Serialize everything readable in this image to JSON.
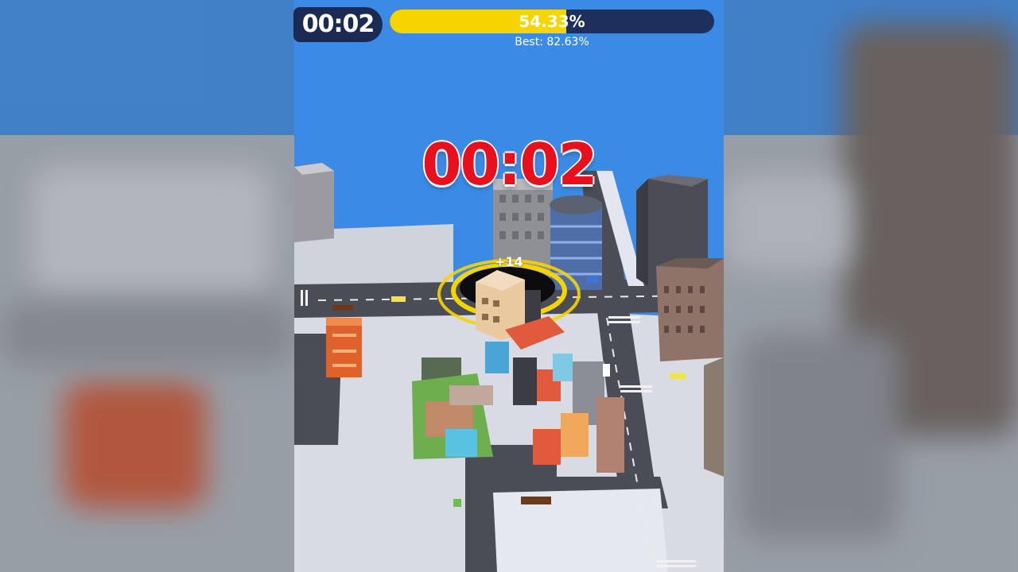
{
  "hud": {
    "timer": "00:02",
    "progress_percent": 54.33,
    "progress_label": "54.33%",
    "best_label": "Best: 82.63%",
    "countdown": "00:02",
    "score_popup": "+14"
  },
  "colors": {
    "sky": "#3b8be6",
    "progress_fill": "#f6d400",
    "progress_track": "#1d2f5c",
    "timer_pill": "#1b2a52",
    "countdown_red": "#e8101c",
    "hole_ring": "#f6d400"
  },
  "scene": {
    "player": "black-hole",
    "icons": [
      "hole-icon",
      "building-icon",
      "car-icon",
      "road-icon"
    ]
  }
}
